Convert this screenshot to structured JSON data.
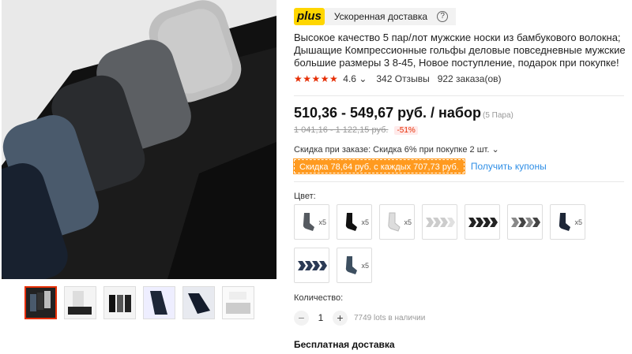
{
  "plus": {
    "badge": "plus",
    "label": "Ускоренная доставка",
    "help_icon": "question-circle-icon"
  },
  "product": {
    "title": "Высокое качество 5 пар/лот мужские носки из бамбукового волокна; Дышащие Компрессионные гольфы деловые повседневные мужские большие размеры 3 8-45, Новое поступление, подарок при покупке!",
    "rating": "4.6",
    "rating_fraction": 0.92,
    "reviews": "342 Отзывы",
    "orders": "922 заказа(ов)"
  },
  "price": {
    "range": "510,36 - 549,67 руб. / набор",
    "unit": "(5 Пара)",
    "old_range": "1 041,16 - 1 122,15 руб.",
    "discount": "-51%"
  },
  "promo": {
    "order_discount": "Скидка при заказе: Скидка 6% при покупке 2 шт.",
    "coupon_tag": "Скидка 78,64 руб. с каждых 707,73 руб.",
    "coupon_link": "Получить купоны"
  },
  "color": {
    "label": "Цвет:",
    "options": [
      {
        "qty": "x5",
        "icon": "sock-gray-icon",
        "color": "#555a60"
      },
      {
        "qty": "x5",
        "icon": "sock-black-icon",
        "color": "#111111"
      },
      {
        "qty": "x5",
        "icon": "sock-white-icon",
        "color": "#dddddd"
      },
      {
        "qty": "",
        "icon": "sock-set-light-icon",
        "color": "#cccccc"
      },
      {
        "qty": "",
        "icon": "sock-set-dark-icon",
        "color": "#222222"
      },
      {
        "qty": "",
        "icon": "sock-set-mixed-icon",
        "color": "#444444"
      },
      {
        "qty": "x5",
        "icon": "sock-navy-icon",
        "color": "#1d2637"
      },
      {
        "qty": "",
        "icon": "sock-set-navy-icon",
        "color": "#2b3a55"
      },
      {
        "qty": "x5",
        "icon": "sock-blue-gray-icon",
        "color": "#3d4f60"
      }
    ]
  },
  "quantity": {
    "label": "Количество:",
    "minus": "−",
    "value": "1",
    "plus": "+",
    "stock": "7749 lots в наличии"
  },
  "shipping": {
    "title": "Бесплатная доставка"
  },
  "colors": {
    "accent": "#e62e04",
    "plus_yellow": "#ffd600",
    "coupon_orange": "#ff9a1f",
    "link_blue": "#2e8ee6"
  }
}
